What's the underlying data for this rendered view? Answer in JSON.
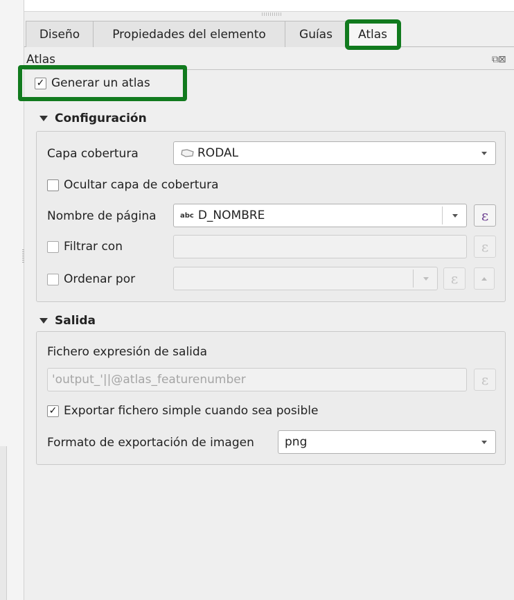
{
  "tabs": [
    {
      "label": "Diseño"
    },
    {
      "label": "Propiedades del elemento"
    },
    {
      "label": "Guías"
    },
    {
      "label": "Atlas"
    }
  ],
  "dock": {
    "title": "Atlas"
  },
  "generate_atlas": {
    "label": "Generar un atlas",
    "checked": true
  },
  "configuracion": {
    "header": "Configuración",
    "coverage_layer": {
      "label": "Capa cobertura",
      "value": "RODAL",
      "icon": "polygon-layer-icon"
    },
    "hide_coverage": {
      "label": "Ocultar capa de cobertura",
      "checked": false
    },
    "page_name": {
      "label": "Nombre de página",
      "value": "D_NOMBRE",
      "field_type": "abc"
    },
    "filter": {
      "label": "Filtrar con",
      "checked": false,
      "value": ""
    },
    "sort": {
      "label": "Ordenar por",
      "checked": false,
      "value": ""
    }
  },
  "salida": {
    "header": "Salida",
    "output_expr_label": "Fichero expresión de salida",
    "output_expr_placeholder": "'output_'||@atlas_featurenumber",
    "single_file": {
      "label": "Exportar fichero simple cuando sea posible",
      "checked": true
    },
    "image_format": {
      "label": "Formato de exportación de imagen",
      "value": "png"
    }
  },
  "icons": {
    "expression": "ε",
    "check": "✓"
  },
  "colors": {
    "highlight": "#117a1e",
    "expression_icon": "#6a3d8f"
  }
}
